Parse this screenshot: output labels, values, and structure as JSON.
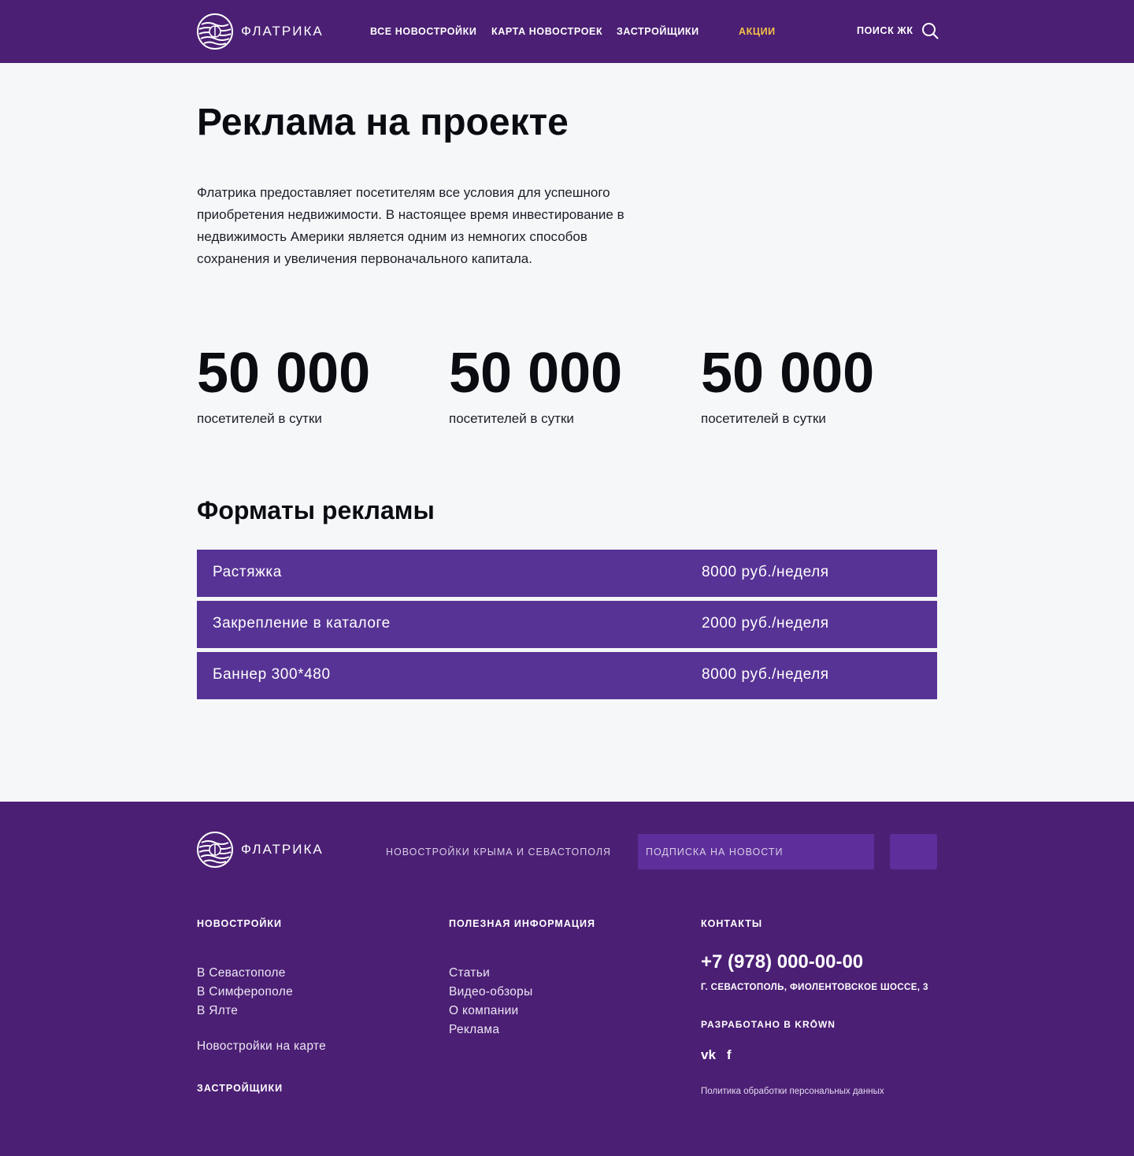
{
  "header": {
    "brand": "ФЛАТРИКА",
    "nav": [
      {
        "label": "ВСЕ НОВОСТРОЙКИ"
      },
      {
        "label": "КАРТА НОВОСТРОЕК"
      },
      {
        "label": "ЗАСТРОЙЩИКИ"
      },
      {
        "label": "АКЦИИ"
      }
    ],
    "search_label": "ПОИСК ЖК",
    "accent_color": "#f5c244"
  },
  "main": {
    "title": "Реклама на проекте",
    "intro": "Флатрика предоставляет посетителям все условия для успешного приобретения недвижимости. В настоящее время инвестирование в недвижимость Америки является одним из немногих способов сохранения и увеличения первоначального капитала.",
    "stats": [
      {
        "value": "50 000",
        "label": "посетителей в сутки"
      },
      {
        "value": "50 000",
        "label": "посетителей в сутки"
      },
      {
        "value": "50 000",
        "label": "посетителей в сутки"
      }
    ],
    "formats_title": "Форматы рекламы",
    "formats": [
      {
        "name": "Растяжка",
        "price": "8000 руб./неделя"
      },
      {
        "name": "Закрепление в каталоге",
        "price": "2000 руб./неделя"
      },
      {
        "name": "Баннер 300*480",
        "price": "8000 руб./неделя"
      }
    ]
  },
  "footer": {
    "brand": "ФЛАТРИКА",
    "tagline": "НОВОСТРОЙКИ КРЫМА И СЕВАСТОПОЛЯ",
    "subscribe_placeholder": "ПОДПИСКА НА НОВОСТИ",
    "col1_head": "НОВОСТРОЙКИ",
    "col1_links": [
      "В Севастополе",
      "В Симферополе",
      "В Ялте"
    ],
    "map_link": "Новостройки на карте",
    "developers_head": "ЗАСТРОЙЩИКИ",
    "col2_head": "ПОЛЕЗНАЯ ИНФОРМАЦИЯ",
    "col2_links": [
      "Статьи",
      "Видео-обзоры",
      "О компании",
      "Реклама"
    ],
    "col3_head": "КОНТАКТЫ",
    "phone": "+7 (978) 000-00-00",
    "address": "Г. СЕВАСТОПОЛЬ, ФИОЛЕНТОВСКОЕ ШОССЕ, 3",
    "made_by": "РАЗРАБОТАНО В KRŌWN",
    "social": [
      {
        "icon": "vk-icon",
        "glyph": "vk"
      },
      {
        "icon": "facebook-icon",
        "glyph": "f"
      }
    ],
    "policy": "Политика обработки персональных данных"
  },
  "colors": {
    "brand_purple": "#4b1f74",
    "row_purple": "#573395",
    "background": "#f6f7f9"
  }
}
